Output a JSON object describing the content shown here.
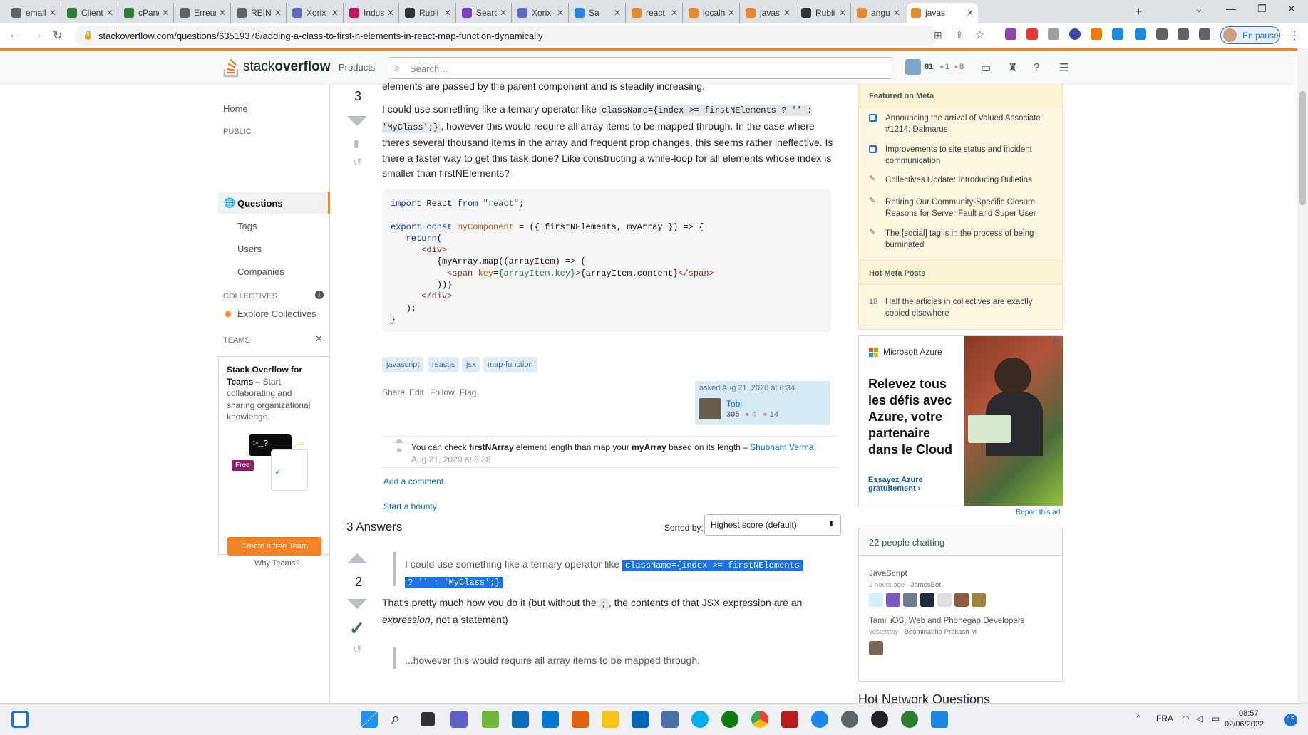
{
  "browser": {
    "tabs": [
      {
        "label": "email",
        "color": "#5f6368"
      },
      {
        "label": "Client",
        "color": "#2e7d32"
      },
      {
        "label": "cPane",
        "color": "#2e7d32"
      },
      {
        "label": "Erreur",
        "color": "#5f6368"
      },
      {
        "label": "REINS",
        "color": "#5f6368"
      },
      {
        "label": "Xorix",
        "color": "#5c6bc0"
      },
      {
        "label": "Indust",
        "color": "#c2185b"
      },
      {
        "label": "Rubii",
        "color": "#333333"
      },
      {
        "label": "Search",
        "color": "#7b3fc4"
      },
      {
        "label": "Xorix",
        "color": "#5c6bc0"
      },
      {
        "label": "Sa",
        "color": "#1e88e5"
      },
      {
        "label": "react",
        "color": "#e68a2e"
      },
      {
        "label": "localh",
        "color": "#e68a2e"
      },
      {
        "label": "javas",
        "color": "#e68a2e"
      },
      {
        "label": "Rubii",
        "color": "#333333"
      },
      {
        "label": "angul",
        "color": "#e68a2e"
      },
      {
        "label": "javas",
        "color": "#e68a2e"
      }
    ],
    "new_tab": "+",
    "url": "stackoverflow.com/questions/63519378/adding-a-class-to-first-n-elements-in-react-map-function-dynamically",
    "pause_label": "En pause"
  },
  "so_header": {
    "logo_prefix": "stack",
    "logo_bold": "overflow",
    "products": "Products",
    "search_placeholder": "Search…",
    "rep": "81",
    "silver": "1",
    "bronze": "8"
  },
  "leftnav": {
    "home": "Home",
    "public": "PUBLIC",
    "questions": "Questions",
    "tags": "Tags",
    "users": "Users",
    "companies": "Companies",
    "collectives": "COLLECTIVES",
    "explore": "Explore Collectives",
    "teams": "TEAMS",
    "teams_title": "Stack Overflow for Teams",
    "teams_desc": " – Start collaborating and sharing organizational knowledge.",
    "free_badge": "Free",
    "create_team": "Create a free Team",
    "why_teams": "Why Teams?"
  },
  "question": {
    "top_partial": "elements are passed by the parent component and is steadily increasing.",
    "votes": "3",
    "para_a": "I could use something like a ternary operator like ",
    "code_ternary": "className={index >= firstNElements ? '' : 'MyClass';}",
    "para_b": ", however this would require all array items to be mapped through. In the case where theres several thousand items in the array and frequent prop changes, this seems rather ineffective. Is there a faster way to get this task done? Like constructing a while-loop for all elements whose index is smaller than firstNElements?",
    "tags": [
      "javascript",
      "reactjs",
      "jsx",
      "map-function"
    ],
    "actions": [
      "Share",
      "Edit",
      "Follow",
      "Flag"
    ],
    "asked": "asked Aug 21, 2020 at 8:34",
    "user": "Tobi",
    "user_rep": "305",
    "user_silver": "4",
    "user_bronze": "14",
    "comment_a": "You can check ",
    "comment_b": "firstNArray",
    "comment_c": " element length than map your ",
    "comment_d": "myArray",
    "comment_e": " based on its length – ",
    "comment_user": "Shubham Verma",
    "comment_date": "Aug 21, 2020 at 8:38",
    "add_comment": "Add a comment",
    "bounty": "Start a bounty"
  },
  "answers": {
    "header": "3 Answers",
    "sorted_by": "Sorted by:",
    "sort_value": "Highest score (default)",
    "votes": "2",
    "quote_text": "I could use something like a ternary operator like ",
    "quote_code_1": "className={index >= firstNElements ",
    "quote_code_2": "? '' : 'MyClass';}",
    "body_a": "That's pretty much how you do it (but without the ",
    "body_code": ";",
    "body_b": ", the contents of that JSX expression are an ",
    "body_em": "expression",
    "body_c": ", not a statement)",
    "quote2": "...however this would require all array items to be mapped through."
  },
  "right": {
    "featured": "Featured on Meta",
    "meta_items": [
      "Announcing the arrival of Valued Associate #1214: Dalmarus",
      "Improvements to site status and incident communication",
      "Collectives Update: Introducing Bulletins",
      "Retiring Our Community-Specific Closure Reasons for Server Fault and Super User",
      "The [social] tag is in the process of being burninated"
    ],
    "hot_meta": "Hot Meta Posts",
    "hot_count": "18",
    "hot_item": "Half the articles in collectives are exactly copied elsewhere",
    "ad_brand": "Microsoft Azure",
    "ad_headline": "Relevez tous les défis avec Azure, votre partenaire dans le Cloud",
    "ad_cta": "Essayez Azure gratuitement",
    "report_ad": "Report this ad",
    "chat_title": "22 people chatting",
    "room1": "JavaScript",
    "room1_meta": "2 hours ago - ",
    "room1_user": "JamesBot",
    "room2": "Tamil iOS, Web and Phonegap Developers",
    "room2_meta": "yesterday - ",
    "room2_user": "Boominadha Prakash M",
    "hot_network": "Hot Network Questions"
  },
  "taskbar": {
    "lang": "FRA",
    "time": "08:57",
    "date": "02/06/2022",
    "notif": "15"
  }
}
